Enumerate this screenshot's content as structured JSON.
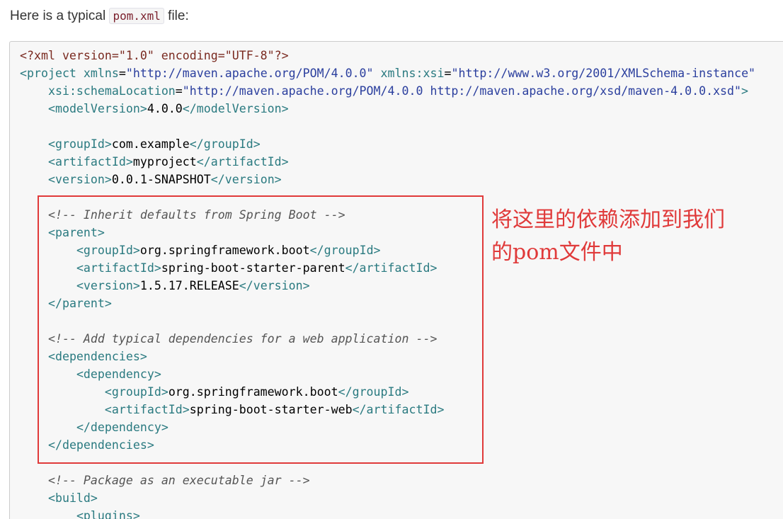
{
  "intro": {
    "prefix": "Here is a typical ",
    "code": "pom.xml",
    "suffix": " file:"
  },
  "code_lines": [
    [
      {
        "t": "pi",
        "v": "<?xml version=\"1.0\" encoding=\"UTF-8\"?>"
      }
    ],
    [
      {
        "t": "tag",
        "v": "<project "
      },
      {
        "t": "attr",
        "v": "xmlns"
      },
      {
        "t": "txt",
        "v": "="
      },
      {
        "t": "str",
        "v": "\"http://maven.apache.org/POM/4.0.0\""
      },
      {
        "t": "txt",
        "v": " "
      },
      {
        "t": "attr",
        "v": "xmlns:xsi"
      },
      {
        "t": "txt",
        "v": "="
      },
      {
        "t": "str",
        "v": "\"http://www.w3.org/2001/XMLSchema-instance\""
      }
    ],
    [
      {
        "t": "txt",
        "v": "    "
      },
      {
        "t": "attr",
        "v": "xsi:schemaLocation"
      },
      {
        "t": "txt",
        "v": "="
      },
      {
        "t": "str",
        "v": "\"http://maven.apache.org/POM/4.0.0 http://maven.apache.org/xsd/maven-4.0.0.xsd\""
      },
      {
        "t": "tag",
        "v": ">"
      }
    ],
    [
      {
        "t": "txt",
        "v": "    "
      },
      {
        "t": "tag",
        "v": "<modelVersion>"
      },
      {
        "t": "txt",
        "v": "4.0.0"
      },
      {
        "t": "tag",
        "v": "</modelVersion>"
      }
    ],
    [],
    [
      {
        "t": "txt",
        "v": "    "
      },
      {
        "t": "tag",
        "v": "<groupId>"
      },
      {
        "t": "txt",
        "v": "com.example"
      },
      {
        "t": "tag",
        "v": "</groupId>"
      }
    ],
    [
      {
        "t": "txt",
        "v": "    "
      },
      {
        "t": "tag",
        "v": "<artifactId>"
      },
      {
        "t": "txt",
        "v": "myproject"
      },
      {
        "t": "tag",
        "v": "</artifactId>"
      }
    ],
    [
      {
        "t": "txt",
        "v": "    "
      },
      {
        "t": "tag",
        "v": "<version>"
      },
      {
        "t": "txt",
        "v": "0.0.1-SNAPSHOT"
      },
      {
        "t": "tag",
        "v": "</version>"
      }
    ],
    [],
    [
      {
        "t": "txt",
        "v": "    "
      },
      {
        "t": "com",
        "v": "<!-- Inherit defaults from Spring Boot -->"
      }
    ],
    [
      {
        "t": "txt",
        "v": "    "
      },
      {
        "t": "tag",
        "v": "<parent>"
      }
    ],
    [
      {
        "t": "txt",
        "v": "        "
      },
      {
        "t": "tag",
        "v": "<groupId>"
      },
      {
        "t": "txt",
        "v": "org.springframework.boot"
      },
      {
        "t": "tag",
        "v": "</groupId>"
      }
    ],
    [
      {
        "t": "txt",
        "v": "        "
      },
      {
        "t": "tag",
        "v": "<artifactId>"
      },
      {
        "t": "txt",
        "v": "spring-boot-starter-parent"
      },
      {
        "t": "tag",
        "v": "</artifactId>"
      }
    ],
    [
      {
        "t": "txt",
        "v": "        "
      },
      {
        "t": "tag",
        "v": "<version>"
      },
      {
        "t": "txt",
        "v": "1.5.17.RELEASE"
      },
      {
        "t": "tag",
        "v": "</version>"
      }
    ],
    [
      {
        "t": "txt",
        "v": "    "
      },
      {
        "t": "tag",
        "v": "</parent>"
      }
    ],
    [],
    [
      {
        "t": "txt",
        "v": "    "
      },
      {
        "t": "com",
        "v": "<!-- Add typical dependencies for a web application -->"
      }
    ],
    [
      {
        "t": "txt",
        "v": "    "
      },
      {
        "t": "tag",
        "v": "<dependencies>"
      }
    ],
    [
      {
        "t": "txt",
        "v": "        "
      },
      {
        "t": "tag",
        "v": "<dependency>"
      }
    ],
    [
      {
        "t": "txt",
        "v": "            "
      },
      {
        "t": "tag",
        "v": "<groupId>"
      },
      {
        "t": "txt",
        "v": "org.springframework.boot"
      },
      {
        "t": "tag",
        "v": "</groupId>"
      }
    ],
    [
      {
        "t": "txt",
        "v": "            "
      },
      {
        "t": "tag",
        "v": "<artifactId>"
      },
      {
        "t": "txt",
        "v": "spring-boot-starter-web"
      },
      {
        "t": "tag",
        "v": "</artifactId>"
      }
    ],
    [
      {
        "t": "txt",
        "v": "        "
      },
      {
        "t": "tag",
        "v": "</dependency>"
      }
    ],
    [
      {
        "t": "txt",
        "v": "    "
      },
      {
        "t": "tag",
        "v": "</dependencies>"
      }
    ],
    [],
    [
      {
        "t": "txt",
        "v": "    "
      },
      {
        "t": "com",
        "v": "<!-- Package as an executable jar -->"
      }
    ],
    [
      {
        "t": "txt",
        "v": "    "
      },
      {
        "t": "tag",
        "v": "<build>"
      }
    ],
    [
      {
        "t": "txt",
        "v": "        "
      },
      {
        "t": "tag",
        "v": "<plugins>"
      }
    ]
  ],
  "annotation": {
    "line1": "将这里的依赖添加到我们",
    "line2": "的pom文件中"
  },
  "colors": {
    "highlight": "#e03a3a",
    "tag": "#2a7a80",
    "string": "#2b3f9e",
    "comment": "#555555"
  }
}
